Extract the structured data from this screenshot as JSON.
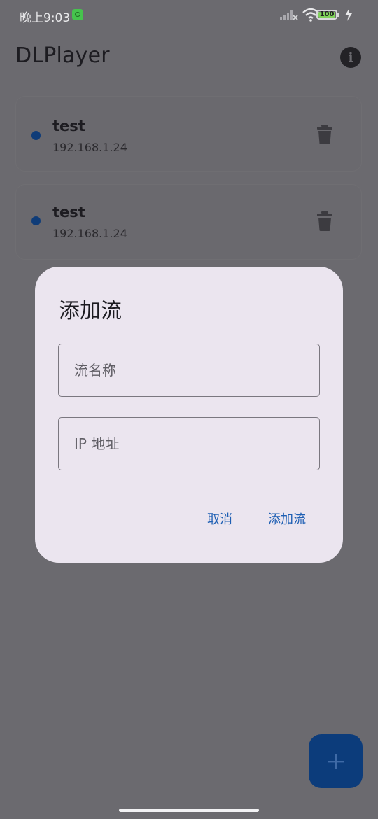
{
  "status_bar": {
    "time": "晚上9:03",
    "battery": "100"
  },
  "app_bar": {
    "title": "DLPlayer",
    "info_icon": "info-icon"
  },
  "streams": [
    {
      "name": "test",
      "ip": "192.168.1.24"
    },
    {
      "name": "test",
      "ip": "192.168.1.24"
    }
  ],
  "dialog": {
    "title": "添加流",
    "name_field": {
      "placeholder": "流名称",
      "value": ""
    },
    "ip_field": {
      "placeholder": "IP 地址",
      "value": ""
    },
    "cancel_label": "取消",
    "confirm_label": "添加流"
  },
  "fab": {
    "icon": "plus-icon"
  },
  "colors": {
    "accent": "#1e5fb3",
    "fab": "#0c3c7b",
    "status_dot": "#0f3c78",
    "scrim": "#6b6a6f",
    "dialog_bg": "#ebe5ef"
  }
}
